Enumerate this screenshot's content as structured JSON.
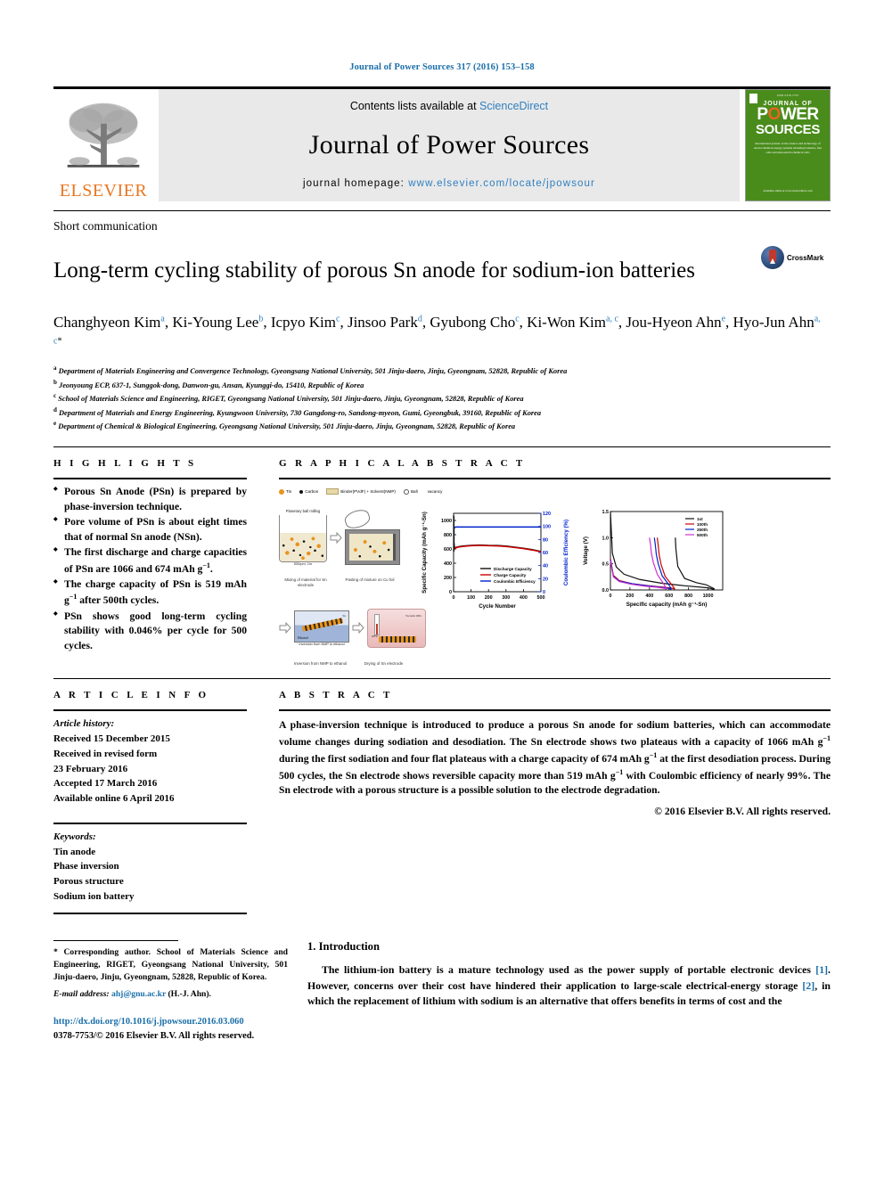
{
  "running_head": "Journal of Power Sources 317 (2016) 153–158",
  "masthead": {
    "contents_prefix": "Contents lists available at ",
    "sciencedirect": "ScienceDirect",
    "journal_name": "Journal of Power Sources",
    "homepage_label": "journal homepage: ",
    "homepage_url": "www.elsevier.com/locate/jpowsour",
    "publisher": "ELSEVIER",
    "cover": {
      "top_line": "ISSN 0378-7753",
      "journal_of": "JOURNAL OF",
      "power": "POWER",
      "sources": "SOURCES",
      "subtitle": "International journal on the science and technology of electrochemical energy systems including batteries, fuel cells and photoelectrochemical cells",
      "footer": "Available online at www.sciencedirect.com"
    }
  },
  "article": {
    "type": "Short communication",
    "title": "Long-term cycling stability of porous Sn anode for sodium-ion batteries",
    "crossmark_label": "CrossMark",
    "authors": [
      {
        "name": "Changhyeon Kim",
        "sup": "a",
        "sep": ", "
      },
      {
        "name": "Ki-Young Lee",
        "sup": "b",
        "sep": ", "
      },
      {
        "name": "Icpyo Kim",
        "sup": "c",
        "sep": ", "
      },
      {
        "name": "Jinsoo Park",
        "sup": "d",
        "sep": ", "
      },
      {
        "name": "Gyubong Cho",
        "sup": "c",
        "sep": ", "
      },
      {
        "name": "Ki-Won Kim",
        "sup": "a, c",
        "sep": ", "
      },
      {
        "name": "Jou-Hyeon Ahn",
        "sup": "e",
        "sep": ", "
      },
      {
        "name": "Hyo-Jun Ahn",
        "sup": "a, c",
        "sep": "",
        "star": "*"
      }
    ],
    "affiliations": [
      {
        "mark": "a",
        "text": "Department of Materials Engineering and Convergence Technology, Gyeongsang National University, 501 Jinju-daero, Jinju, Gyeongnam, 52828, Republic of Korea"
      },
      {
        "mark": "b",
        "text": "Jeonyoung ECP, 637-1, Sunggok-dong, Danwon-gu, Ansan, Kyunggi-do, 15410, Republic of Korea"
      },
      {
        "mark": "c",
        "text": "School of Materials Science and Engineering, RIGET, Gyeongsang National University, 501 Jinju-daero, Jinju, Gyeongnam, 52828, Republic of Korea"
      },
      {
        "mark": "d",
        "text": "Department of Materials and Energy Engineering, Kyungwoon University, 730 Gangdong-ro, Sandong-myeon, Gumi, Gyeongbuk, 39160, Republic of Korea"
      },
      {
        "mark": "e",
        "text": "Department of Chemical & Biological Engineering, Gyeongsang National University, 501 Jinju-daero, Jinju, Gyeongnam, 52828, Republic of Korea"
      }
    ]
  },
  "highlights": {
    "heading": "H I G H L I G H T S",
    "items": [
      "Porous Sn Anode (PSn) is prepared by phase-inversion technique.",
      "Pore volume of PSn is about eight times that of normal Sn anode (NSn).",
      "The first discharge and charge capacities of PSn are 1066 and 674 mAh g−1.",
      "The charge capacity of PSn is 519 mAh g−1 after 500th cycles.",
      "PSn shows good long-term cycling stability with 0.046% per cycle for 500 cycles."
    ]
  },
  "graphical_abstract": {
    "heading": "G R A P H I C A L   A B S T R A C T",
    "legend": [
      {
        "key": "tin",
        "label": "Tin"
      },
      {
        "key": "carbon",
        "label": "Carbon"
      },
      {
        "key": "binder",
        "label": "Binder(PVdF) + Solvent(NMP)"
      },
      {
        "key": "ball",
        "label": "Ball"
      },
      {
        "key": "vacancy",
        "label": "vacancy"
      }
    ],
    "diagram": {
      "step1_top": "Planetary ball milling",
      "step1_mini": "500rpm, 1hr",
      "step1_cap": "Mixing of material for Sn electrode",
      "step2_cap": "Pasting of mixture on Cu foil",
      "step3_sn": "Sn",
      "step3_ethanol": "Ethanol",
      "step3_sub": "Inversion from NMP to ethanol",
      "step3_cap": "Inversion from NMP to ethanol",
      "step4_temp": "20°C",
      "step4_vac": "Vacuum 48hr",
      "step4_cap": "Drying of Sn electrode"
    }
  },
  "chart_data": [
    {
      "type": "line",
      "title": "",
      "xlabel": "Cycle Number",
      "ylabel": "Specific Capacity (mAh g⁻¹-Sn)",
      "y2label": "Coulombic Efficiency (%)",
      "xlim": [
        0,
        500
      ],
      "ylim": [
        0,
        1100
      ],
      "y2lim": [
        0,
        120
      ],
      "xticks": [
        0,
        100,
        200,
        300,
        400,
        500
      ],
      "yticks": [
        0,
        200,
        400,
        600,
        800,
        1000
      ],
      "y2ticks": [
        0,
        20,
        40,
        60,
        80,
        100,
        120
      ],
      "legend": [
        {
          "name": "Discharge Capacity",
          "color": "#111111"
        },
        {
          "name": "Charge Capacity",
          "color": "#cc0000"
        },
        {
          "name": "Coulombic Efficiency",
          "color": "#0022cc"
        }
      ],
      "series": [
        {
          "name": "Discharge Capacity",
          "color": "#111111",
          "x": [
            1,
            2,
            5,
            10,
            25,
            50,
            100,
            150,
            200,
            250,
            300,
            350,
            400,
            450,
            500
          ],
          "y": [
            1066,
            700,
            610,
            620,
            630,
            640,
            650,
            655,
            650,
            648,
            640,
            625,
            610,
            590,
            565
          ]
        },
        {
          "name": "Charge Capacity",
          "color": "#cc0000",
          "x": [
            1,
            2,
            5,
            10,
            25,
            50,
            100,
            150,
            200,
            250,
            300,
            350,
            400,
            450,
            500
          ],
          "y": [
            674,
            585,
            600,
            612,
            625,
            635,
            645,
            650,
            645,
            642,
            635,
            620,
            605,
            585,
            560
          ]
        },
        {
          "name": "Coulombic Efficiency",
          "color": "#0022cc",
          "x": [
            1,
            2,
            5,
            10,
            50,
            100,
            200,
            300,
            400,
            500
          ],
          "y": [
            63,
            96,
            98,
            99,
            99,
            99,
            99,
            99,
            99,
            99
          ]
        }
      ]
    },
    {
      "type": "line",
      "title": "",
      "xlabel": "Specific capacity (mAh g⁻¹-Sn)",
      "ylabel": "Voltage (V)",
      "xlim": [
        0,
        1150
      ],
      "ylim": [
        0,
        1.5
      ],
      "xticks": [
        0,
        200,
        400,
        600,
        800,
        1000
      ],
      "yticks": [
        0.0,
        0.5,
        1.0,
        1.5
      ],
      "legend": [
        {
          "name": "1st",
          "color": "#111111"
        },
        {
          "name": "100th",
          "color": "#cc0000"
        },
        {
          "name": "250th",
          "color": "#0022cc"
        },
        {
          "name": "500th",
          "color": "#cc33cc"
        }
      ],
      "series": [
        {
          "name": "1st-discharge",
          "color": "#111111",
          "x": [
            0,
            20,
            60,
            140,
            300,
            520,
            760,
            1000,
            1066
          ],
          "y": [
            1.5,
            0.7,
            0.44,
            0.3,
            0.2,
            0.13,
            0.08,
            0.04,
            0.01
          ]
        },
        {
          "name": "1st-charge",
          "color": "#111111",
          "x": [
            1066,
            980,
            880,
            760,
            690,
            680,
            670,
            665
          ],
          "y": [
            0.02,
            0.1,
            0.14,
            0.22,
            0.45,
            0.62,
            0.8,
            1.0
          ]
        },
        {
          "name": "100th-discharge",
          "color": "#cc0000",
          "x": [
            0,
            30,
            90,
            220,
            400,
            560,
            640,
            660
          ],
          "y": [
            0.6,
            0.28,
            0.18,
            0.12,
            0.08,
            0.05,
            0.03,
            0.01
          ]
        },
        {
          "name": "100th-charge",
          "color": "#cc0000",
          "x": [
            660,
            620,
            560,
            520,
            500,
            490,
            480
          ],
          "y": [
            0.02,
            0.12,
            0.26,
            0.48,
            0.66,
            0.84,
            1.0
          ]
        },
        {
          "name": "250th-discharge",
          "color": "#0022cc",
          "x": [
            0,
            30,
            90,
            220,
            380,
            520,
            600,
            625
          ],
          "y": [
            0.58,
            0.26,
            0.17,
            0.12,
            0.08,
            0.05,
            0.03,
            0.01
          ]
        },
        {
          "name": "250th-charge",
          "color": "#0022cc",
          "x": [
            625,
            590,
            530,
            490,
            470,
            460,
            450
          ],
          "y": [
            0.02,
            0.12,
            0.27,
            0.5,
            0.68,
            0.86,
            1.0
          ]
        },
        {
          "name": "500th-discharge",
          "color": "#cc33cc",
          "x": [
            0,
            30,
            90,
            210,
            360,
            480,
            555,
            575
          ],
          "y": [
            0.56,
            0.25,
            0.16,
            0.11,
            0.07,
            0.05,
            0.03,
            0.01
          ]
        },
        {
          "name": "500th-charge",
          "color": "#cc33cc",
          "x": [
            575,
            540,
            480,
            440,
            420,
            410,
            400
          ],
          "y": [
            0.02,
            0.13,
            0.3,
            0.52,
            0.7,
            0.88,
            1.0
          ]
        }
      ]
    }
  ],
  "article_info": {
    "heading": "A R T I C L E   I N F O",
    "history_label": "Article history:",
    "history": [
      "Received 15 December 2015",
      "Received in revised form",
      "23 February 2016",
      "Accepted 17 March 2016",
      "Available online 6 April 2016"
    ],
    "keywords_label": "Keywords:",
    "keywords": [
      "Tin anode",
      "Phase inversion",
      "Porous structure",
      "Sodium ion battery"
    ]
  },
  "abstract": {
    "heading": "A B S T R A C T",
    "body_1": "A phase-inversion technique is introduced to produce a porous Sn anode for sodium batteries, which can accommodate volume changes during sodiation and desodiation. The Sn electrode shows two plateaus with a capacity of 1066 mAh g",
    "sup_1": "−1",
    "body_2": " during the first sodiation and four flat plateaus with a charge capacity of 674 mAh g",
    "sup_2": "−1",
    "body_3": " at the first desodiation process. During 500 cycles, the Sn electrode shows reversible capacity more than 519 mAh g",
    "sup_3": "−1",
    "body_4": " with Coulombic efficiency of nearly 99%. The Sn electrode with a porous structure is a possible solution to the electrode degradation.",
    "copyright": "© 2016 Elsevier B.V. All rights reserved."
  },
  "footer": {
    "corresponding": "* Corresponding author. School of Materials Science and Engineering, RIGET, Gyeongsang National University, 501 Jinju-daero, Jinju, Gyeongnam, 52828, Republic of Korea.",
    "email_label": "E-mail address:",
    "email": "ahj@gnu.ac.kr",
    "email_owner": "(H.-J. Ahn).",
    "doi": "http://dx.doi.org/10.1016/j.jpowsour.2016.03.060",
    "issn_line": "0378-7753/© 2016 Elsevier B.V. All rights reserved."
  },
  "introduction": {
    "heading": "1. Introduction",
    "p1_a": "The lithium-ion battery is a mature technology used as the power supply of portable electronic devices ",
    "ref1": "[1]",
    "p1_b": ". However, concerns over their cost have hindered their application to large-scale electrical-energy storage ",
    "ref2": "[2]",
    "p1_c": ", in which the replacement of lithium with sodium is an alternative that offers benefits in terms of cost and the"
  },
  "colors": {
    "link": "#1a6fa8",
    "elsevier_orange": "#E87722",
    "cover_green": "#4a8c1c"
  }
}
